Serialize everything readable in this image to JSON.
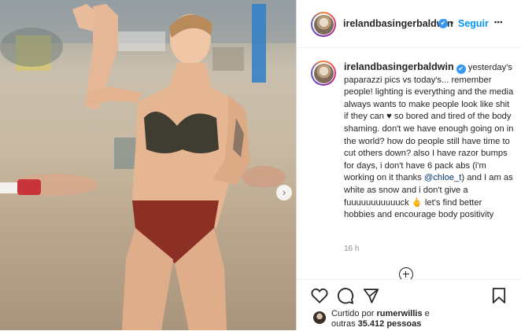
{
  "header": {
    "username": "irelandbasingerbaldwin",
    "verified_mark": "✔",
    "separator": "•",
    "follow_label": "Seguir",
    "more_label": "•••"
  },
  "caption": {
    "username": "irelandbasingerbaldwin",
    "verified_mark": "✔",
    "text_before_mention": "yesterday's paparazzi pics vs today's... remember people! lighting is everything and the media always wants to make people look like shit if they can ♥ so bored and tired of the body shaming. don't we have enough going on in the world? how do people still have time to cut others down? also I have razor bumps for days, i don't have 6 pack abs (i'm working on it thanks",
    "mention": "@chloe_t",
    "text_after_mention": ") and I am as white as snow and i don't give a fuuuuuuuuuuuck 🖕 let's find better hobbies and encourage body positivity"
  },
  "timestamp": "16 h",
  "likes": {
    "prefix": "Curtido por ",
    "user": "rumerwillis",
    "middle": " e",
    "line2_prefix": "outras ",
    "count": "35.412 pessoas"
  },
  "photo": {
    "next_arrow": "›"
  },
  "icons": {
    "heart": "heart-icon",
    "comment": "comment-icon",
    "share": "share-icon",
    "bookmark": "bookmark-icon",
    "add_comment": "add-comment-icon"
  }
}
